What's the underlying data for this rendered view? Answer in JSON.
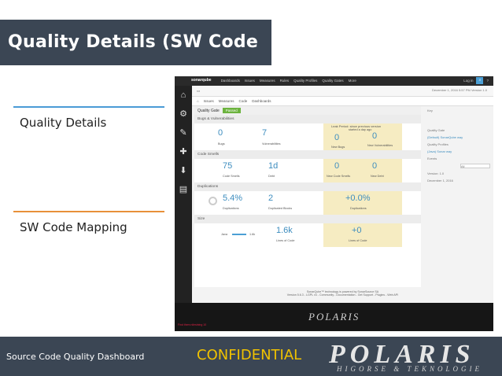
{
  "slide": {
    "title": "Quality Details (SW Code Nav.)",
    "menu": [
      "Quality Details",
      "SW Code Mapping"
    ],
    "footer": {
      "source": "Source Code Quality Dashboard",
      "confidential": "CONFIDENTIAL",
      "logo": "POLARIS",
      "logo_sub": "HIGORSE & TEKNOLOGIE"
    }
  },
  "sonar": {
    "nav": [
      "sonarqube",
      "Dashboards",
      "Issues",
      "Measures",
      "Rules",
      "Quality Profiles",
      "Quality Gates",
      "More"
    ],
    "login": "Log in",
    "subnav": [
      "Issues",
      "Measures",
      "Code",
      "Dashboards"
    ],
    "date": "December 1, 2016 5:57 PM  Version 1.0",
    "quality_gate": {
      "label": "Quality Gate",
      "status": "Passed"
    },
    "sections": {
      "bugs": "Bugs & Vulnerabilities",
      "smells": "Code Smells",
      "dup": "Duplications",
      "size": "Size"
    },
    "leak": {
      "title": "Leak Period: since previous version",
      "sub": "started a day ago"
    },
    "bugs": {
      "value": "0",
      "label": "Bugs",
      "rating": "A",
      "vuln_value": "7",
      "vuln_label": "Vulnerabilities",
      "vuln_rating": "E",
      "new_bugs": "0",
      "new_bugs_label": "New Bugs",
      "new_vuln": "0",
      "new_vuln_label": "New Vulnerabilities"
    },
    "smells": {
      "value": "75",
      "label": "Code Smells",
      "rating": "A",
      "debt": "1d",
      "debt_label": "Debt",
      "new_smells": "0",
      "new_smells_label": "New Code Smells",
      "new_debt": "0",
      "new_debt_label": "New Debt"
    },
    "dup": {
      "value": "5.4%",
      "label": "Duplications",
      "blocks": "2",
      "blocks_label": "Duplicated Blocks",
      "new": "+0.0%",
      "new_label": "Duplications"
    },
    "size": {
      "value": "1.6k",
      "label": "Lines of Code",
      "lang": "Java",
      "lang_val": "1.6k",
      "new": "+0",
      "new_label": "Lines of Code"
    },
    "right": {
      "key": "Key",
      "qg_title": "Quality Gate",
      "qg_val": "(Default) SonarQube way",
      "qp_title": "Quality Profiles",
      "qp_val": "(Java) Sonar way",
      "events": "Events",
      "events_sel": "All",
      "version": "Version: 1.0",
      "version_date": "December 1, 2016"
    },
    "footer1": "SonarQube™ technology is powered by SonarSource SA",
    "footer2": "Version 5.6.3 - LGPL v3 - Community - Documentation - Get Support - Plugins - Web API",
    "banner": "POLARIS",
    "tiny": "Find them nilestning 10"
  }
}
